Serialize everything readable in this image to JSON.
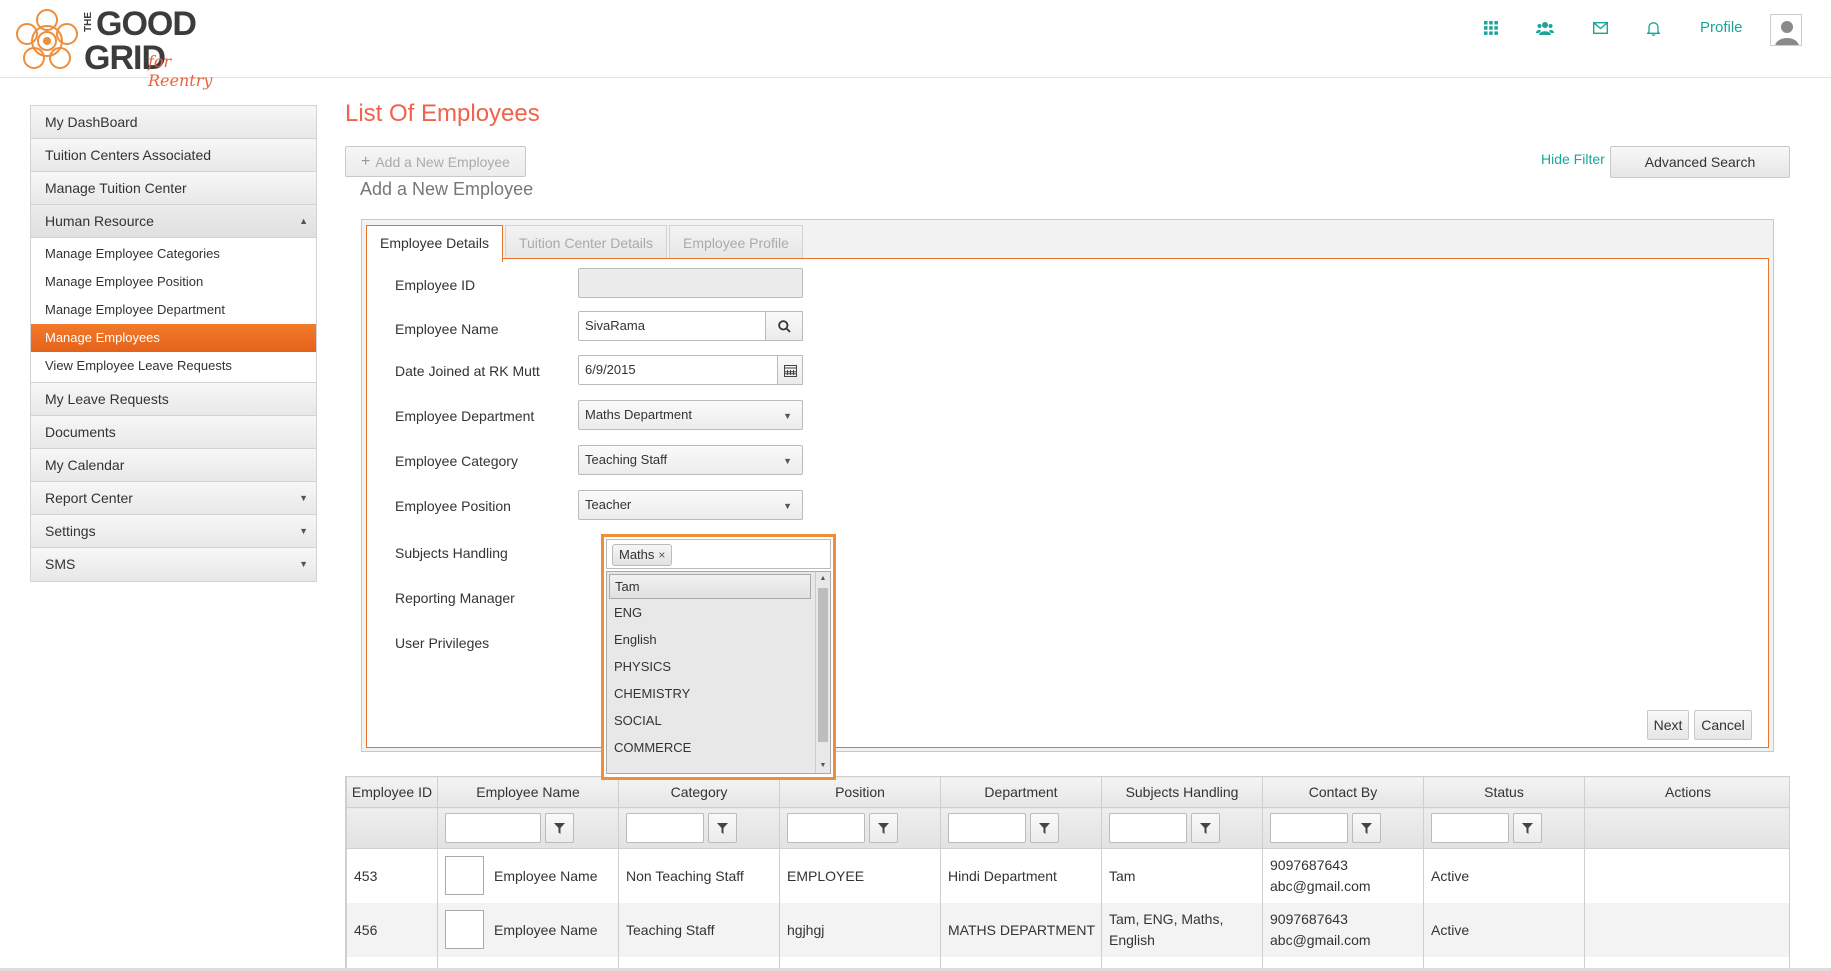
{
  "header": {
    "logo": {
      "the": "THE",
      "good": "GOOD",
      "grid": "GRID",
      "tagline": "for Reentry"
    },
    "icons": [
      "apps-grid-icon",
      "users-icon",
      "mail-icon",
      "bell-icon"
    ],
    "profile_label": "Profile",
    "accent_color": "#1aa59a"
  },
  "sidebar": {
    "items": [
      {
        "label": "My DashBoard"
      },
      {
        "label": "Tuition Centers Associated"
      },
      {
        "label": "Manage Tuition Center"
      },
      {
        "label": "Human Resource",
        "expanded": true,
        "children": [
          {
            "label": "Manage Employee Categories"
          },
          {
            "label": "Manage Employee Position"
          },
          {
            "label": "Manage Employee Department"
          },
          {
            "label": "Manage Employees",
            "active": true
          },
          {
            "label": "View Employee Leave Requests"
          }
        ]
      },
      {
        "label": "My Leave Requests"
      },
      {
        "label": "Documents"
      },
      {
        "label": "My Calendar"
      },
      {
        "label": "Report Center",
        "has_caret": true
      },
      {
        "label": "Settings",
        "has_caret": true
      },
      {
        "label": "SMS",
        "has_caret": true
      }
    ],
    "active_color": "#e8681f"
  },
  "main": {
    "title": "List Of Employees",
    "add_button": "Add a New Employee",
    "hide_filter": "Hide Filter",
    "advanced_search": "Advanced Search",
    "form_heading": "Add a New Employee"
  },
  "form": {
    "tabs": [
      "Employee Details",
      "Tuition Center Details",
      "Employee Profile"
    ],
    "active_tab": "Employee Details",
    "labels": {
      "employee_id": "Employee ID",
      "employee_name": "Employee Name",
      "date_joined": "Date Joined at RK Mutt",
      "department": "Employee Department",
      "category": "Employee Category",
      "position": "Employee Position",
      "subjects": "Subjects Handling",
      "reporting_manager": "Reporting Manager",
      "user_privileges": "User Privileges"
    },
    "values": {
      "employee_id": "",
      "employee_name": "SivaRama",
      "date_joined": "6/9/2015",
      "department": "Maths Department",
      "category": "Teaching Staff",
      "position": "Teacher"
    },
    "subjects_selected": [
      "Maths"
    ],
    "subjects_options": [
      "Tam",
      "ENG",
      "English",
      "PHYSICS",
      "CHEMISTRY",
      "SOCIAL",
      "COMMERCE"
    ],
    "highlighted_option": "Tam",
    "next_label": "Next",
    "cancel_label": "Cancel",
    "border_color": "#e8732a"
  },
  "table": {
    "columns": [
      "Employee ID",
      "Employee Name",
      "Category",
      "Position",
      "Department",
      "Subjects Handling",
      "Contact By",
      "Status",
      "Actions"
    ],
    "rows": [
      {
        "id": "453",
        "name": "Employee Name",
        "category": "Non Teaching Staff",
        "position": "EMPLOYEE",
        "department": "Hindi Department",
        "subjects": "Tam",
        "phone": "9097687643",
        "email": "abc@gmail.com",
        "status": "Active"
      },
      {
        "id": "456",
        "name": "Employee Name",
        "category": "Teaching Staff",
        "position": "hgjhgj",
        "department": "MATHS DEPARTMENT",
        "subjects_line1": "Tam, ENG, Maths,",
        "subjects_line2": "English",
        "phone": "9097687643",
        "email": "abc@gmail.com",
        "status": "Active"
      }
    ]
  }
}
